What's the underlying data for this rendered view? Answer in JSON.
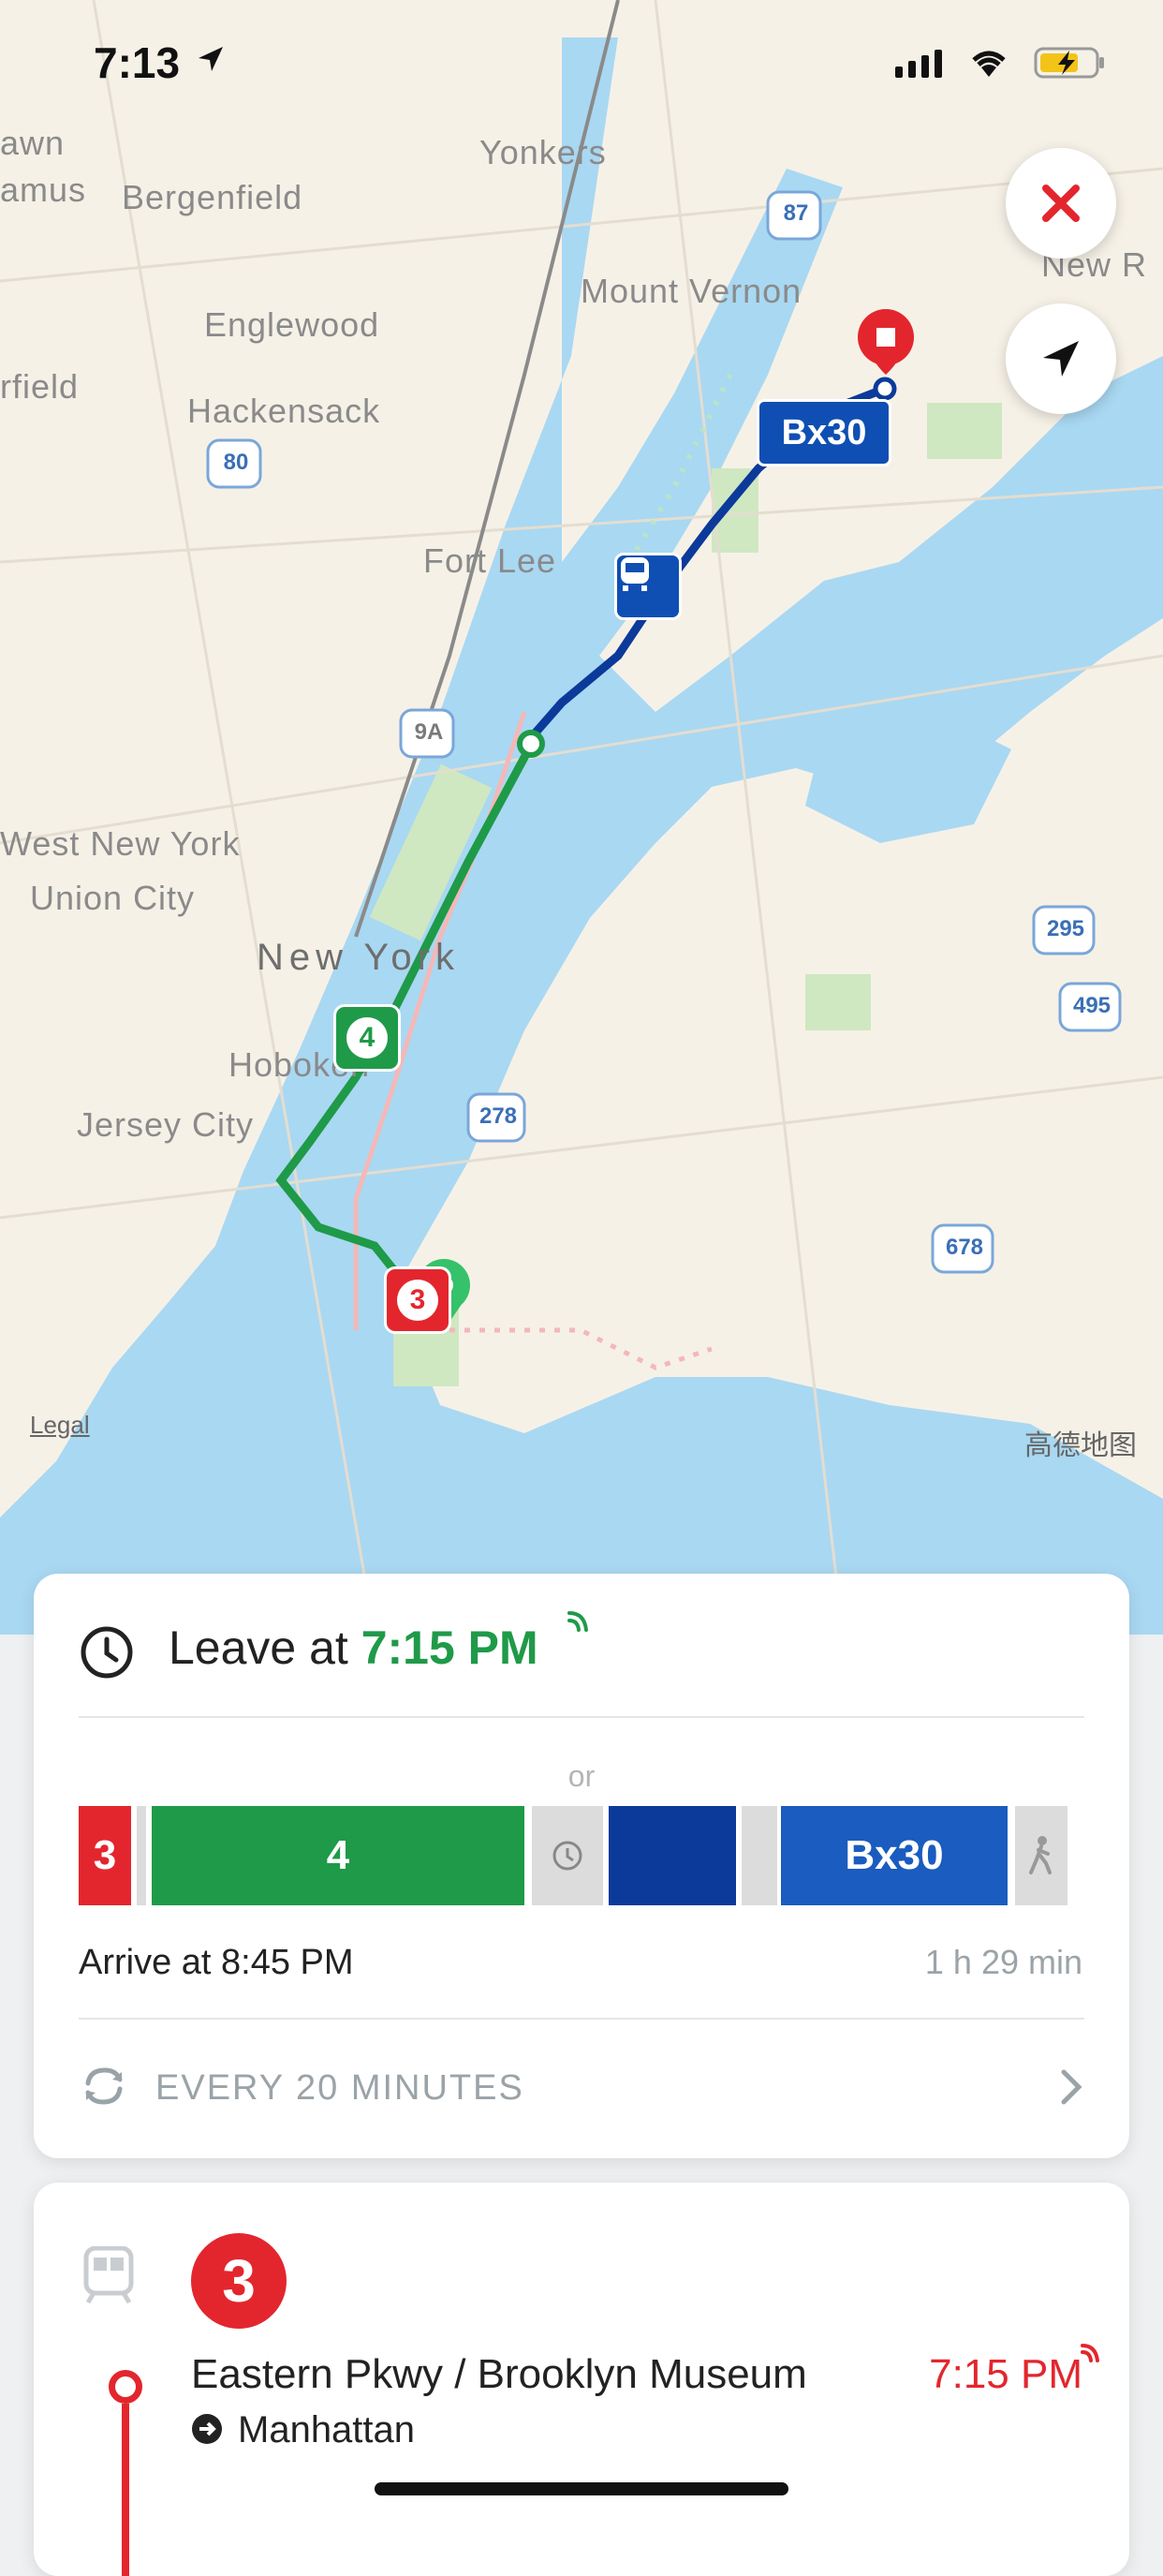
{
  "status_bar": {
    "time": "7:13"
  },
  "map": {
    "place_labels": [
      "Yonkers",
      "Bergenfield",
      "Mount Vernon",
      "Englewood",
      "Hackensack",
      "Fort Lee",
      "West New York",
      "Union City",
      "New York",
      "Hoboken",
      "Jersey City",
      "awn",
      "amus",
      "rfield",
      "New R"
    ],
    "shields": [
      "87",
      "80",
      "9A",
      "278",
      "295",
      "495",
      "678"
    ],
    "route_labels": {
      "bus": "Bx30",
      "subway": "4",
      "start_line": "3"
    },
    "legal": "Legal",
    "provider": "高德地图"
  },
  "trip": {
    "leave_prefix": "Leave at ",
    "leave_time": "7:15 PM",
    "or_label": "or",
    "segments": {
      "first": "3",
      "second": "4",
      "fourth": "Bx30"
    },
    "arrive": "Arrive at 8:45 PM",
    "duration": "1 h 29 min",
    "frequency": "EVERY 20 MINUTES"
  },
  "step": {
    "line": "3",
    "stop": "Eastern Pkwy / Brooklyn Museum",
    "time": "7:15 PM",
    "direction": "Manhattan"
  },
  "colors": {
    "green": "#1f9a48",
    "red": "#e3262d",
    "blue": "#0f4fb3",
    "navy": "#0b3a9a",
    "grey": "#dcdcdc"
  }
}
